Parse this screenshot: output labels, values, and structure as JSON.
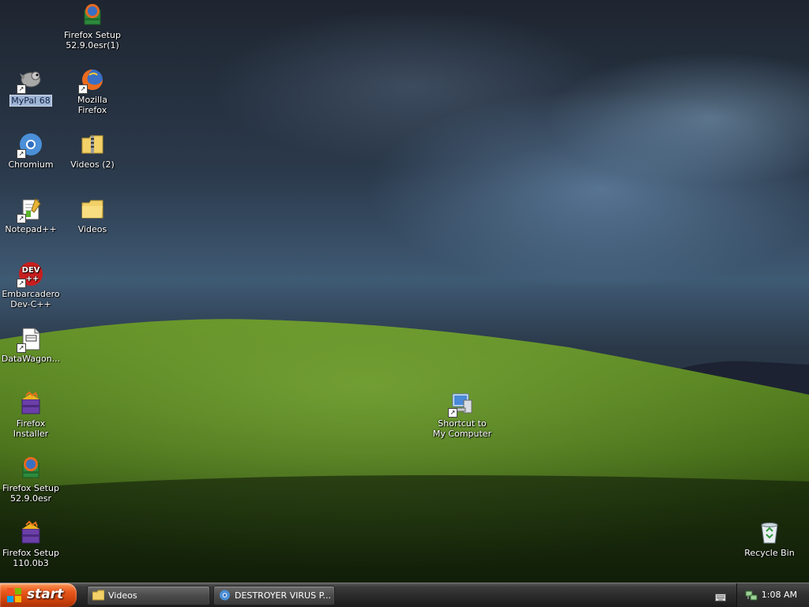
{
  "desktop": {
    "icons": [
      {
        "label": "Firefox Setup 52.9.0esr(1)",
        "icon": "firefox-setup-icon"
      },
      {
        "label": "MyPal 68",
        "icon": "mypal-icon"
      },
      {
        "label": "Mozilla Firefox",
        "icon": "firefox-icon"
      },
      {
        "label": "Chromium",
        "icon": "chromium-icon"
      },
      {
        "label": "Videos (2)",
        "icon": "zip-folder-icon"
      },
      {
        "label": "Notepad++",
        "icon": "notepad-plus-plus-icon"
      },
      {
        "label": "Videos",
        "icon": "folder-icon"
      },
      {
        "label": "Embarcadero Dev-C++",
        "icon": "dev-cpp-icon"
      },
      {
        "label": "DataWagon...",
        "icon": "document-icon"
      },
      {
        "label": "Firefox Installer",
        "icon": "firefox-installer-icon"
      },
      {
        "label": "Firefox Setup 52.9.0esr",
        "icon": "firefox-setup-icon"
      },
      {
        "label": "Firefox Setup 110.0b3",
        "icon": "firefox-installer-icon"
      },
      {
        "label": "Shortcut to My Computer",
        "icon": "my-computer-icon"
      },
      {
        "label": "Recycle Bin",
        "icon": "recycle-bin-icon"
      }
    ]
  },
  "taskbar": {
    "start_label": "start",
    "tasks": [
      {
        "label": "Videos",
        "icon": "folder-icon"
      },
      {
        "label": "DESTROYER VIRUS P...",
        "icon": "chromium-icon"
      }
    ],
    "tray": {
      "clock": "1:08 AM",
      "icons": [
        "keyboard-icon",
        "network-icon"
      ]
    }
  },
  "colors": {
    "start_orange": "#e8581c",
    "taskbar": "#2a2a2a",
    "selection": "#9fb5d6"
  }
}
